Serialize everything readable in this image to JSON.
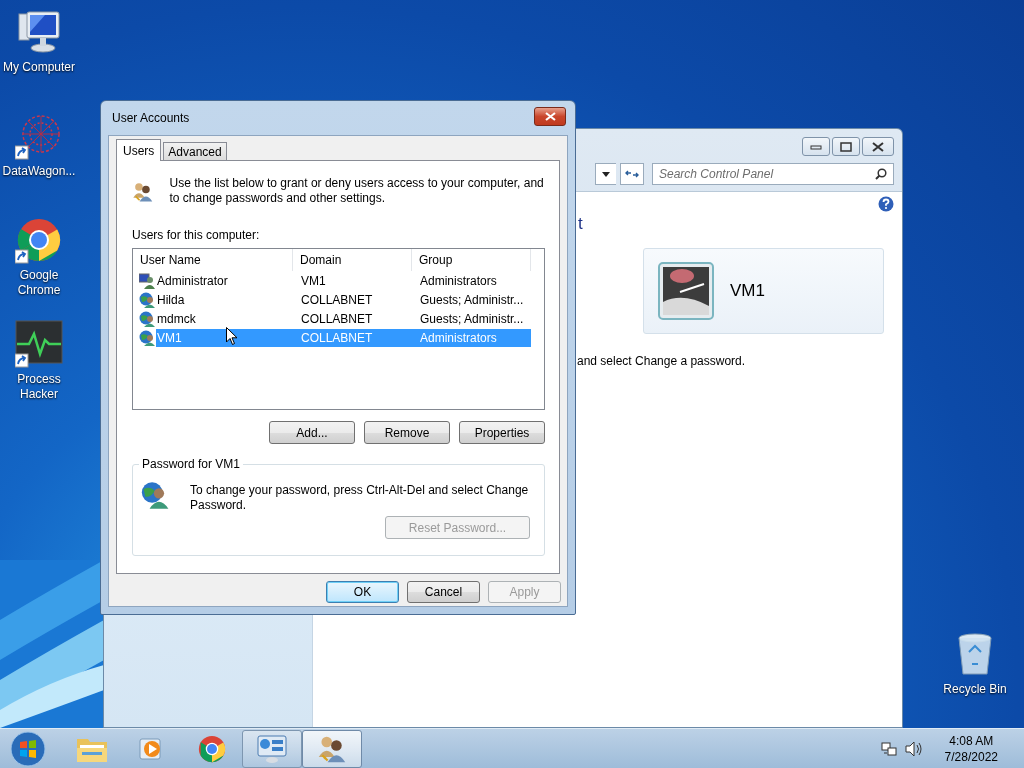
{
  "desktop_icons": [
    {
      "label": "My Computer",
      "kind": "computer",
      "shortcut": false
    },
    {
      "label": "DataWagon...",
      "kind": "network",
      "shortcut": true
    },
    {
      "label": "Google Chrome",
      "kind": "chrome",
      "shortcut": true
    },
    {
      "label": "Process Hacker",
      "kind": "monitor",
      "shortcut": true
    }
  ],
  "recycle_bin": {
    "label": "Recycle Bin"
  },
  "control_panel_window": {
    "search": {
      "placeholder": "Search Control Panel"
    },
    "heading_fragment": "t",
    "user_card": {
      "name": "VM1"
    },
    "instruction_fragment": "and select Change a password."
  },
  "dialog": {
    "title": "User Accounts",
    "tabs": [
      {
        "label": "Users",
        "selected": true
      },
      {
        "label": "Advanced",
        "selected": false
      }
    ],
    "intro": "Use the list below to grant or deny users access to your computer, and to change passwords and other settings.",
    "list_label": "Users for this computer:",
    "table": {
      "columns": [
        "User Name",
        "Domain",
        "Group"
      ],
      "rows": [
        {
          "user_name": "Administrator",
          "domain": "VM1",
          "group": "Administrators",
          "kind": "local",
          "selected": false
        },
        {
          "user_name": "Hilda",
          "domain": "COLLABNET",
          "group": "Guests; Administr...",
          "kind": "domain",
          "selected": false
        },
        {
          "user_name": "mdmck",
          "domain": "COLLABNET",
          "group": "Guests; Administr...",
          "kind": "domain",
          "selected": false
        },
        {
          "user_name": "VM1",
          "domain": "COLLABNET",
          "group": "Administrators",
          "kind": "domain",
          "selected": true
        }
      ]
    },
    "list_buttons": [
      {
        "label": "Add...",
        "disabled": false
      },
      {
        "label": "Remove",
        "disabled": false
      },
      {
        "label": "Properties",
        "disabled": false
      }
    ],
    "password_group": {
      "title": "Password for VM1",
      "text": "To change your password, press Ctrl-Alt-Del and select Change Password.",
      "button": {
        "label": "Reset Password...",
        "disabled": true
      }
    },
    "buttons": [
      {
        "label": "OK",
        "default": true,
        "disabled": false
      },
      {
        "label": "Cancel",
        "default": false,
        "disabled": false
      },
      {
        "label": "Apply",
        "default": false,
        "disabled": true
      }
    ]
  },
  "taskbar": {
    "items": [
      {
        "kind": "explorer",
        "selected": false,
        "running": false
      },
      {
        "kind": "media",
        "selected": false,
        "running": false
      },
      {
        "kind": "chrome",
        "selected": false,
        "running": false
      },
      {
        "kind": "control-panel",
        "selected": false,
        "running": true
      },
      {
        "kind": "users",
        "selected": true,
        "running": true
      }
    ],
    "clock": {
      "time": "4:08 AM",
      "date": "7/28/2022"
    }
  }
}
